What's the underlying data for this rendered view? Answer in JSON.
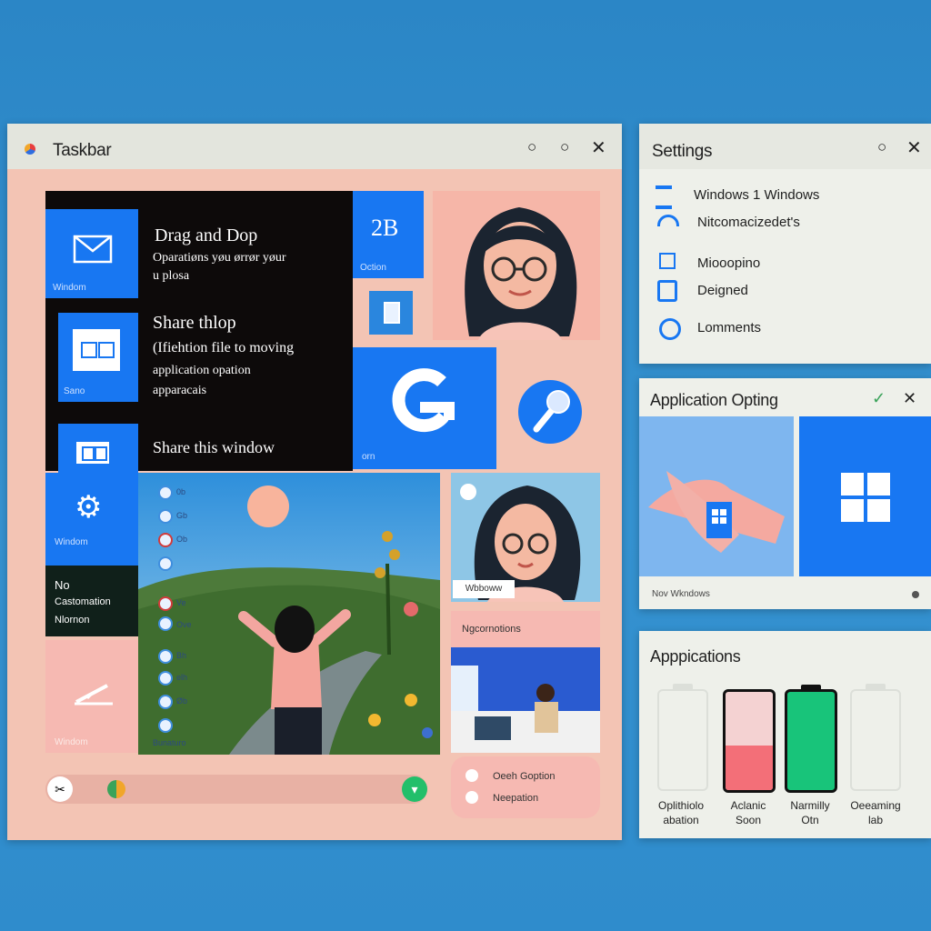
{
  "taskbar": {
    "title": "Taskbar",
    "dark_panel": {
      "heading1": "Drag and Dop",
      "sub1": "Oparatiøns yøu ørrør yøur",
      "sub1b": "u plosa",
      "heading2": "Share thlop",
      "sub2": "(Ifiehtion file to moving",
      "sub2b": "application opation",
      "sub2c": "apparacais",
      "heading3": "Share this window"
    },
    "tiles": {
      "mail_label": "Windom",
      "doc_label": "Sano",
      "settings_label": "Windom",
      "number_tile_value": "2B",
      "number_tile_label": "Oction",
      "g_tile_label": "orn"
    },
    "notification_panel": {
      "line1": "No",
      "line2": "Castomation",
      "line3": "Nlornon"
    },
    "pink_tile_label": "Windom",
    "landscape_icons": [
      {
        "label": "0b"
      },
      {
        "label": "Gb"
      },
      {
        "label": "Ob"
      },
      {
        "label": ""
      },
      {
        "label": "Ve"
      },
      {
        "label": "Ove"
      },
      {
        "label": "Bh"
      },
      {
        "label": "elh"
      },
      {
        "label": "Øb"
      },
      {
        "label": "Bunaturo"
      }
    ],
    "portrait_badge": "Wbboww",
    "section_title": "Ngcornotions",
    "option_card": {
      "opt1": "Oeeh Goption",
      "opt2": "Neepation"
    }
  },
  "settings": {
    "title": "Settings",
    "items": [
      {
        "label": "Windows 1 Windows",
        "icon": "ribbon-icon"
      },
      {
        "label": "Nitcomacizedet's",
        "icon": "headphones-icon"
      },
      {
        "label": "Miooopino",
        "icon": "square-icon"
      },
      {
        "label": "Deigned",
        "icon": "lock-icon"
      },
      {
        "label": "Lomments",
        "icon": "people-icon"
      }
    ]
  },
  "app_opting": {
    "title": "Application Opting",
    "footer_label": "Nov Wkndows"
  },
  "applications": {
    "title": "Apppications",
    "batteries": [
      {
        "level": 0.0,
        "color": "#e6e9e4",
        "line1": "Oplithiolo",
        "line2": "abation"
      },
      {
        "level": 0.45,
        "color": "#f36f78",
        "line1": "Aclanic",
        "line2": "Soon"
      },
      {
        "level": 0.92,
        "color": "#18c47a",
        "line1": "Narmilly",
        "line2": "Otn"
      },
      {
        "level": 0.0,
        "color": "#e6e9e4",
        "line1": "Oeeaming",
        "line2": "lab"
      }
    ]
  },
  "colors": {
    "accent": "#1877f2",
    "window_bg": "#f3c4b4",
    "dark_panel": "#0d0a0a",
    "titlebar": "#e3e5dd",
    "green_button": "#22bf6a"
  }
}
